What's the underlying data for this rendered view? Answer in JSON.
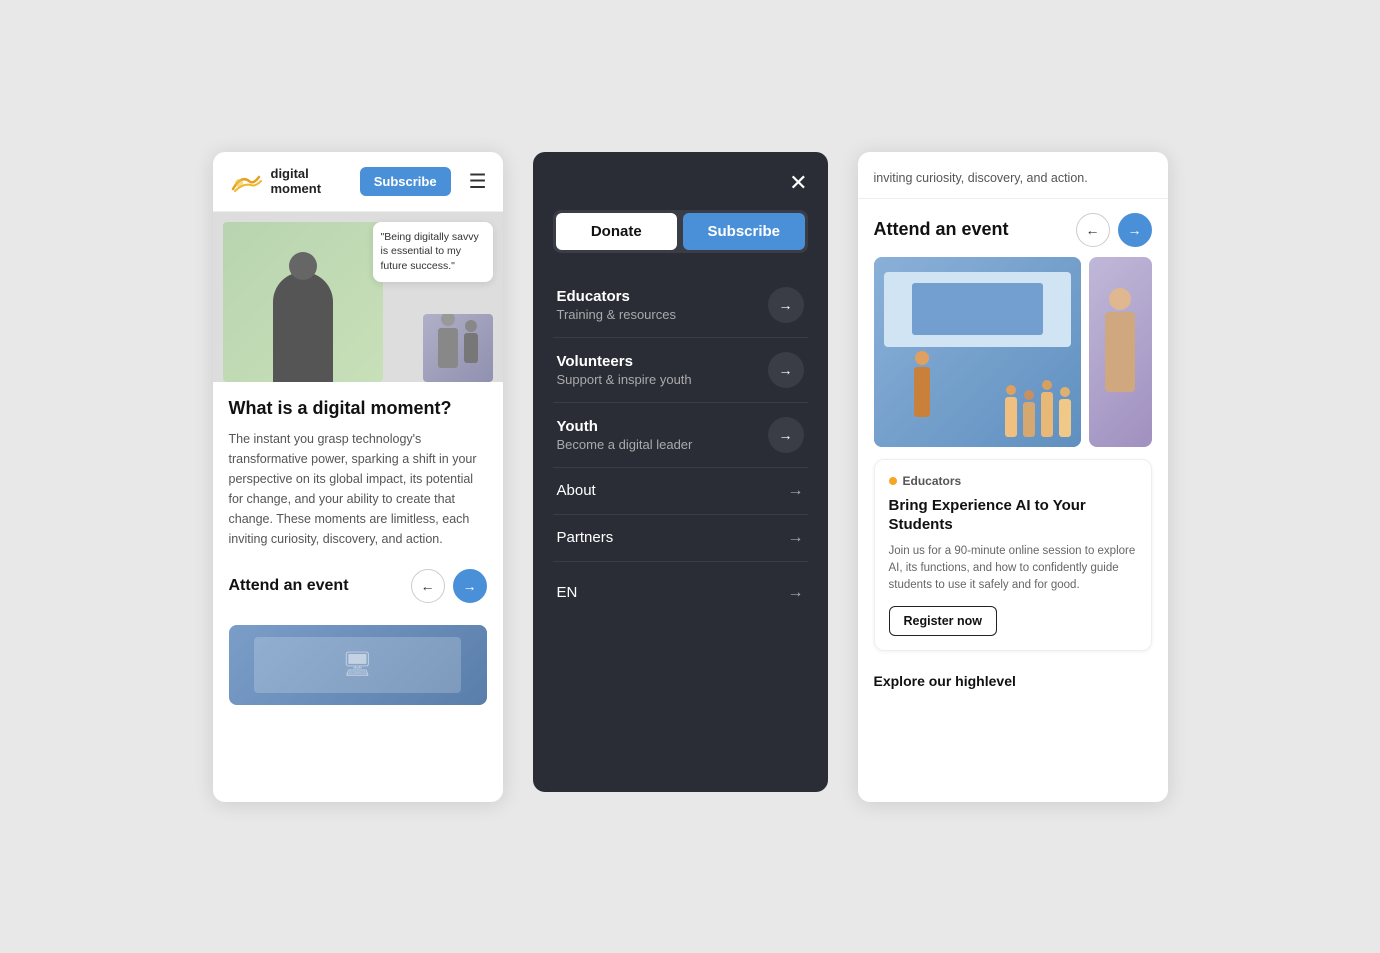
{
  "panel1": {
    "logo_text_line1": "digital",
    "logo_text_line2": "moment",
    "subscribe_label": "Subscribe",
    "quote_text": "\"Being digitally savvy is essential to my future success.\"",
    "title": "What is a digital moment?",
    "body": "The instant you grasp technology's transformative power, sparking a shift in your perspective on its global impact, its potential for change, and your ability to create that change. These moments are limitless, each inviting curiosity, discovery, and action.",
    "event_title": "Attend an event",
    "nav_prev_label": "←",
    "nav_next_label": "→"
  },
  "panel2": {
    "close_label": "✕",
    "donate_label": "Donate",
    "subscribe_label": "Subscribe",
    "menu_items": [
      {
        "title": "Educators",
        "subtitle": "Training & resources"
      },
      {
        "title": "Volunteers",
        "subtitle": "Support & inspire youth"
      },
      {
        "title": "Youth",
        "subtitle": "Become a digital leader"
      }
    ],
    "simple_items": [
      {
        "label": "About"
      },
      {
        "label": "Partners"
      }
    ],
    "lang_label": "EN",
    "arrow": "→"
  },
  "panel3": {
    "top_text": "inviting curiosity, discovery, and action.",
    "attend_title": "Attend an event",
    "nav_prev_label": "←",
    "nav_next_label": "→",
    "card": {
      "tag": "Educators",
      "title": "Bring Experience AI to Your Students",
      "description": "Join us for a 90-minute online session to explore AI, its functions, and how to confidently guide students to use it safely and for good.",
      "register_label": "Register now"
    },
    "explore_title": "Explore our highlevel"
  }
}
